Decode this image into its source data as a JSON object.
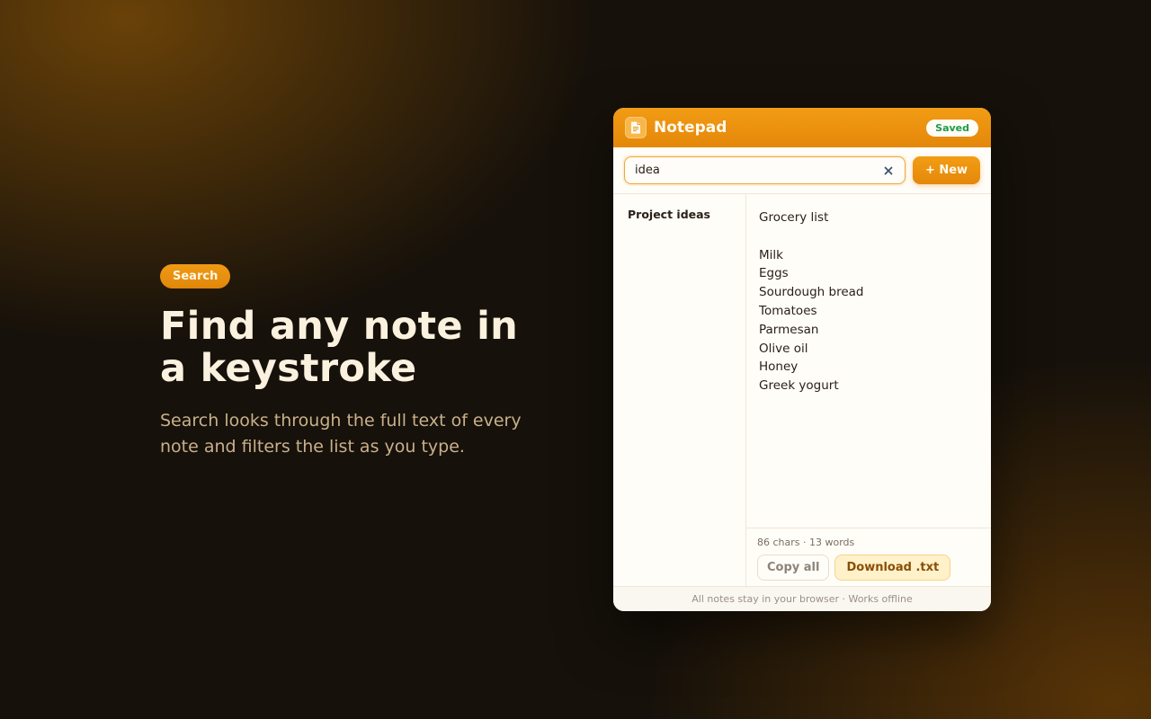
{
  "hero": {
    "badge": "Search",
    "headline": "Find any note in a keystroke",
    "subtitle": "Search looks through the full text of every note and filters the list as you type."
  },
  "app": {
    "title": "Notepad",
    "icon": "note-icon",
    "status": "Saved",
    "status_color": "#1f9a4a",
    "accent": "#f09a14"
  },
  "toolbar": {
    "search_value": "idea",
    "clear_icon": "close-icon",
    "new_label": "+ New"
  },
  "sidebar": {
    "notes": [
      {
        "title": "Project ideas"
      }
    ]
  },
  "editor": {
    "content": "Grocery list\n\nMilk\nEggs\nSourdough bread\nTomatoes\nParmesan\nOlive oil\nHoney\nGreek yogurt",
    "stats": "86 chars · 13 words",
    "copy_label": "Copy all",
    "download_label": "Download .txt"
  },
  "footer": {
    "text": "All notes stay in your browser · Works offline"
  }
}
